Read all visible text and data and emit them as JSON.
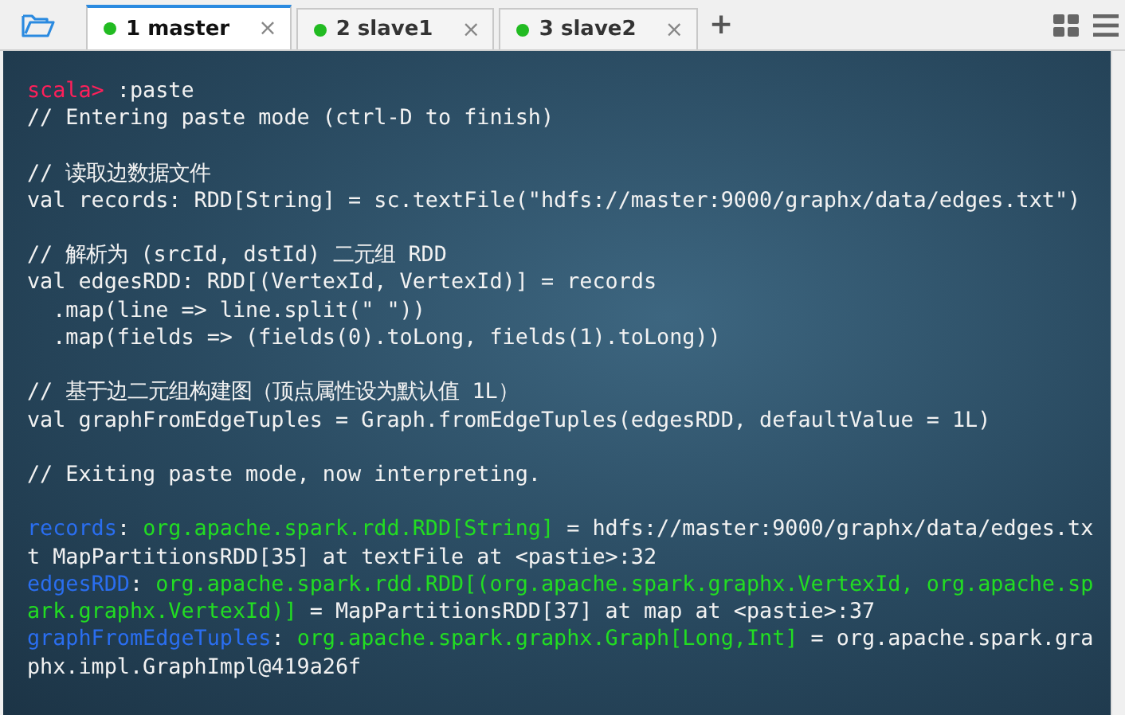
{
  "tabs": [
    {
      "label": "1 master",
      "selected": true,
      "color": "#22bb22",
      "close": "×"
    },
    {
      "label": "2 slave1",
      "selected": false,
      "color": "#22bb22",
      "close": "×"
    },
    {
      "label": "3 slave2",
      "selected": false,
      "color": "#22bb22",
      "close": "×"
    }
  ],
  "new_tab": "+",
  "terminal": {
    "blocks": [
      [
        [
          {
            "kind": "prompt",
            "text": "scala>"
          },
          {
            "kind": "plain",
            "text": " :paste"
          }
        ],
        [
          {
            "kind": "plain",
            "text": "// Entering paste mode (ctrl-D to finish)"
          }
        ]
      ],
      [
        [
          {
            "kind": "plain",
            "text": "// 读取边数据文件"
          }
        ],
        [
          {
            "kind": "plain",
            "text": "val records: RDD[String] = sc.textFile(\"hdfs://master:9000/graphx/data/edges.txt\")"
          }
        ]
      ],
      [
        [
          {
            "kind": "plain",
            "text": "// 解析为 (srcId, dstId) 二元组 RDD"
          }
        ],
        [
          {
            "kind": "plain",
            "text": "val edgesRDD: RDD[(VertexId, VertexId)] = records"
          }
        ],
        [
          {
            "kind": "plain",
            "text": "  .map(line => line.split(\" \"))"
          }
        ],
        [
          {
            "kind": "plain",
            "text": "  .map(fields => (fields(0).toLong, fields(1).toLong))"
          }
        ]
      ],
      [
        [
          {
            "kind": "plain",
            "text": "// 基于边二元组构建图（顶点属性设为默认值 1L）"
          }
        ],
        [
          {
            "kind": "plain",
            "text": "val graphFromEdgeTuples = Graph.fromEdgeTuples(edgesRDD, defaultValue = 1L)"
          }
        ]
      ],
      [
        [
          {
            "kind": "plain",
            "text": "// Exiting paste mode, now interpreting."
          }
        ]
      ],
      [
        [
          {
            "kind": "var",
            "text": "records"
          },
          {
            "kind": "plain",
            "text": ": "
          },
          {
            "kind": "type",
            "text": "org.apache.spark.rdd.RDD[String]"
          },
          {
            "kind": "plain",
            "text": " = hdfs://master:9000/graphx/data/edges.tx"
          }
        ],
        [
          {
            "kind": "plain",
            "text": "t MapPartitionsRDD[35] at textFile at <pastie>:32"
          }
        ],
        [
          {
            "kind": "var",
            "text": "edgesRDD"
          },
          {
            "kind": "plain",
            "text": ": "
          },
          {
            "kind": "type",
            "text": "org.apache.spark.rdd.RDD[(org.apache.spark.graphx.VertexId, org.apache.sp"
          }
        ],
        [
          {
            "kind": "type",
            "text": "ark.graphx.VertexId)]"
          },
          {
            "kind": "plain",
            "text": " = MapPartitionsRDD[37] at map at <pastie>:37"
          }
        ],
        [
          {
            "kind": "var",
            "text": "graphFromEdgeTuples"
          },
          {
            "kind": "plain",
            "text": ": "
          },
          {
            "kind": "type",
            "text": "org.apache.spark.graphx.Graph[Long,Int]"
          },
          {
            "kind": "plain",
            "text": " = org.apache.spark.gra"
          }
        ],
        [
          {
            "kind": "plain",
            "text": "phx.impl.GraphImpl@419a26f"
          }
        ]
      ]
    ]
  }
}
